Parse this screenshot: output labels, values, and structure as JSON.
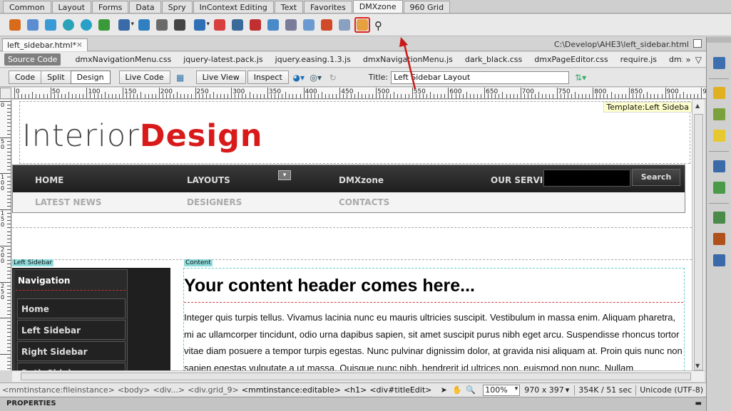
{
  "insert_tabs": [
    "Common",
    "Layout",
    "Forms",
    "Data",
    "Spry",
    "InContext Editing",
    "Text",
    "Favorites",
    "DMXzone",
    "960 Grid"
  ],
  "active_insert_tab": "DMXzone",
  "toolbar_icons": [
    "dmx-menu-icon",
    "page-icon",
    "globe-icon",
    "pause-icon",
    "circle-icon",
    "chart-icon",
    "widget-dropdown-icon",
    "swirl-icon",
    "gear-puzzle-icon",
    "clapper-icon",
    "image-dropdown-icon",
    "slideshow-icon",
    "monitor-icon",
    "dialog-icon",
    "layers-icon",
    "page-edit-icon",
    "flash-icon",
    "browser-icon",
    "form-icon",
    "page-editor-icon",
    "search-icon"
  ],
  "document": {
    "tab_name": "left_sidebar.html*",
    "path": "C:\\Develop\\AHE3\\left_sidebar.html"
  },
  "related_files": {
    "source_code_label": "Source Code",
    "files": [
      "dmxNavigationMenu.css",
      "jquery-latest.pack.js",
      "jquery.easing.1.3.js",
      "dmxNavigationMenu.js",
      "dark_black.css",
      "dmxPageEditor.css",
      "require.js",
      "dmxPageEditor"
    ]
  },
  "doc_toolbar": {
    "code": "Code",
    "split": "Split",
    "design": "Design",
    "live_code": "Live Code",
    "live_view": "Live View",
    "inspect": "Inspect",
    "title_label": "Title:",
    "title_value": "Left Sidebar Layout"
  },
  "ruler": {
    "h_labels": [
      "0",
      "50",
      "100",
      "150",
      "200",
      "250",
      "300",
      "350",
      "400",
      "450",
      "500",
      "550",
      "600",
      "650",
      "700",
      "750",
      "800",
      "850",
      "900",
      "950"
    ],
    "v_labels": [
      "0",
      "50",
      "100",
      "150",
      "200",
      "250"
    ]
  },
  "page": {
    "template_flag": "Template:Left Sideba",
    "logo_part1": "Interior",
    "logo_part2": "Design",
    "nav_top": [
      "HOME",
      "LAYOUTS",
      "DMXzone",
      "OUR SERVICE"
    ],
    "nav_sub": [
      "LATEST NEWS",
      "DESIGNERS",
      "CONTACTS"
    ],
    "search_button": "Search",
    "left_sidebar_label": "Left Sidebar",
    "content_label": "Content",
    "sidebar_heading": "Navigation",
    "sidebar_items": [
      "Home",
      "Left Sidebar",
      "Right Sidebar",
      "Both Sidebars"
    ],
    "content_heading": "Your content header comes here...",
    "content_paragraph": "Integer quis turpis tellus. Vivamus lacinia nunc eu mauris ultricies suscipit. Vestibulum in massa enim. Aliquam pharetra, mi ac ullamcorper tincidunt, odio urna dapibus sapien, sit amet suscipit purus nibh eget arcu. Suspendisse rhoncus tortor vitae diam posuere a tempor turpis egestas. Nunc pulvinar dignissim dolor, at gravida nisi aliquam at. Proin quis nunc non sapien egestas vulputate a ut massa. Quisque nunc nibh, hendrerit id ultrices non, euismod non nunc. Nullam"
  },
  "status": {
    "tags": [
      "<mmtinstance:fileinstance>",
      "<body>",
      "<div...>",
      "<div.grid_9>",
      "<mmtinstance:editable>",
      "<h1>",
      "<div#titleEdit>"
    ],
    "zoom": "100%",
    "dimensions": "970 x 397",
    "size": "354K / 51 sec",
    "encoding": "Unicode (UTF-8)"
  },
  "properties_label": "PROPERTIES",
  "colors": {
    "brand_red": "#d81a1a",
    "nav_dark": "#1e1e1e",
    "highlight_red": "#d22222"
  }
}
